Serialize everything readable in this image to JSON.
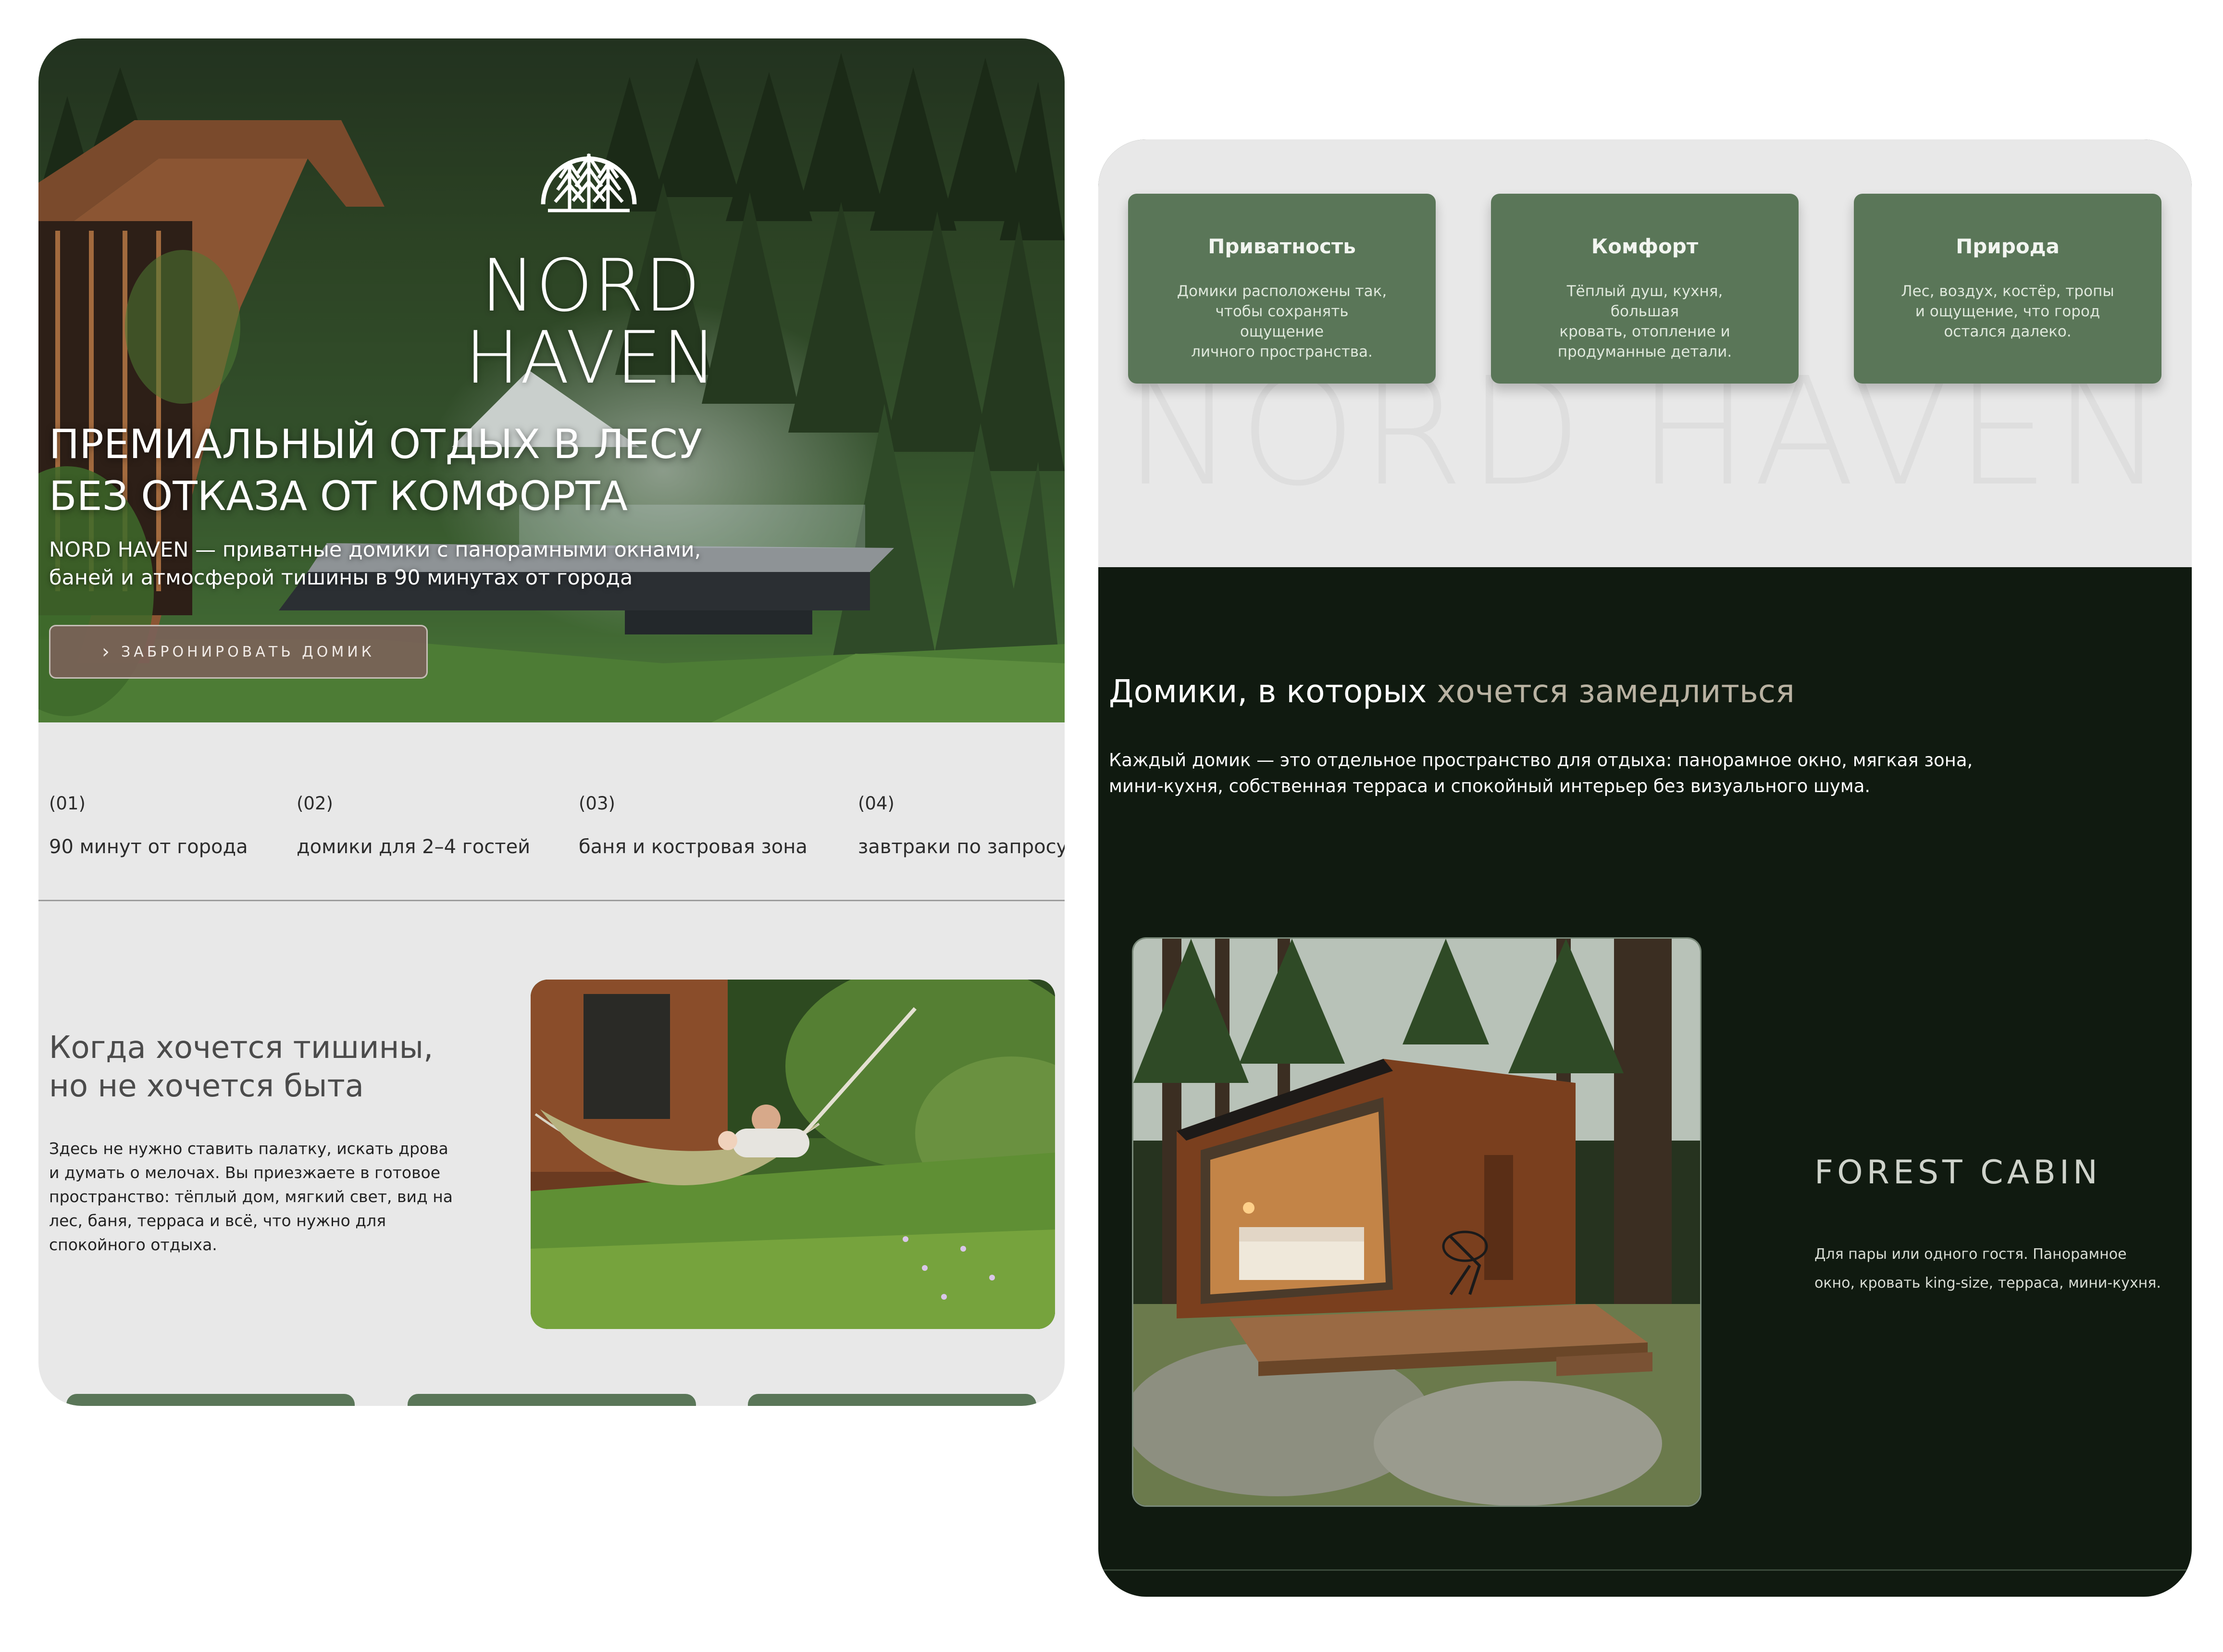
{
  "landing": {
    "brand": "NORD HAVEN",
    "hero": {
      "title_line1": "ПРЕМИАЛЬНЫЙ ОТДЫХ В ЛЕСУ",
      "title_line2": "БЕЗ ОТКАЗА ОТ КОМФОРТА",
      "subtitle_line1": "NORD HAVEN — приватные домики с панорамными окнами,",
      "subtitle_line2": "баней и атмосферой тишины в 90 минутах от города",
      "button_label": "ЗАБРОНИРОВАТЬ ДОМИК"
    },
    "features": [
      {
        "num": "(01)",
        "text": "90 минут от города"
      },
      {
        "num": "(02)",
        "text": "домики для 2–4 гостей"
      },
      {
        "num": "(03)",
        "text": "баня и костровая зона"
      },
      {
        "num": "(04)",
        "text": "завтраки по запросу"
      }
    ],
    "quiet": {
      "title_line1": "Когда хочется тишины,",
      "title_line2": "но не хочется быта",
      "text_lines": [
        "Здесь не нужно ставить палатку, искать дрова",
        "и думать о мелочах. Вы приезжаете в готовое",
        "пространство: тёплый дом, мягкий свет, вид на",
        "лес, баня, терраса и всё, что нужно для",
        "спокойного отдыха."
      ]
    }
  },
  "details": {
    "watermark": "NORD HAVEN",
    "values": [
      {
        "title": "Приватность",
        "lines": [
          "Домики расположены так,",
          "чтобы сохранять ощущение",
          "личного пространства."
        ]
      },
      {
        "title": "Комфорт",
        "lines": [
          "Тёплый душ, кухня, большая",
          "кровать, отопление и",
          "продуманные детали."
        ]
      },
      {
        "title": "Природа",
        "lines": [
          "Лес, воздух, костёр, тропы",
          "и ощущение, что город",
          "остался далеко."
        ]
      }
    ],
    "cabins": {
      "heading_main": "Домики, в которых ",
      "heading_accent": "хочется замедлиться",
      "desc_line1": "Каждый домик — это отдельное пространство для отдыха: панорамное окно, мягкая зона,",
      "desc_line2": "мини-кухня, собственная терраса и спокойный интерьер без визуального шума.",
      "cabin_name": "FOREST CABIN",
      "cabin_desc_line1": "Для пары или одного гостя. Панорамное",
      "cabin_desc_line2": "окно, кровать king-size, терраса, мини-кухня."
    }
  },
  "colors": {
    "accent_green": "#5a7658",
    "dark_bg": "#101a10",
    "light_bg": "#e8e8e8",
    "button_brown": "#7a6258"
  }
}
